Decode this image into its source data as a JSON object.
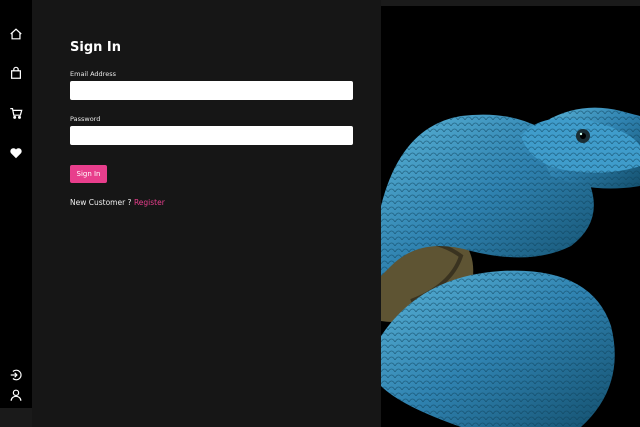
{
  "sidebar": {
    "items": [
      {
        "icon": "home-icon"
      },
      {
        "icon": "shopping-bag-icon"
      },
      {
        "icon": "cart-icon"
      },
      {
        "icon": "heart-icon"
      },
      {
        "icon": "logout-icon"
      },
      {
        "icon": "user-icon"
      }
    ]
  },
  "signin": {
    "title": "Sign In",
    "email_label": "Email Address",
    "email_value": "",
    "password_label": "Password",
    "password_value": "",
    "submit_label": "Sign In",
    "new_customer_text": "New Customer ?",
    "register_link": "Register"
  },
  "colors": {
    "accent": "#e83e8c",
    "sidebar_bg": "#000000",
    "panel_bg": "#161616"
  }
}
